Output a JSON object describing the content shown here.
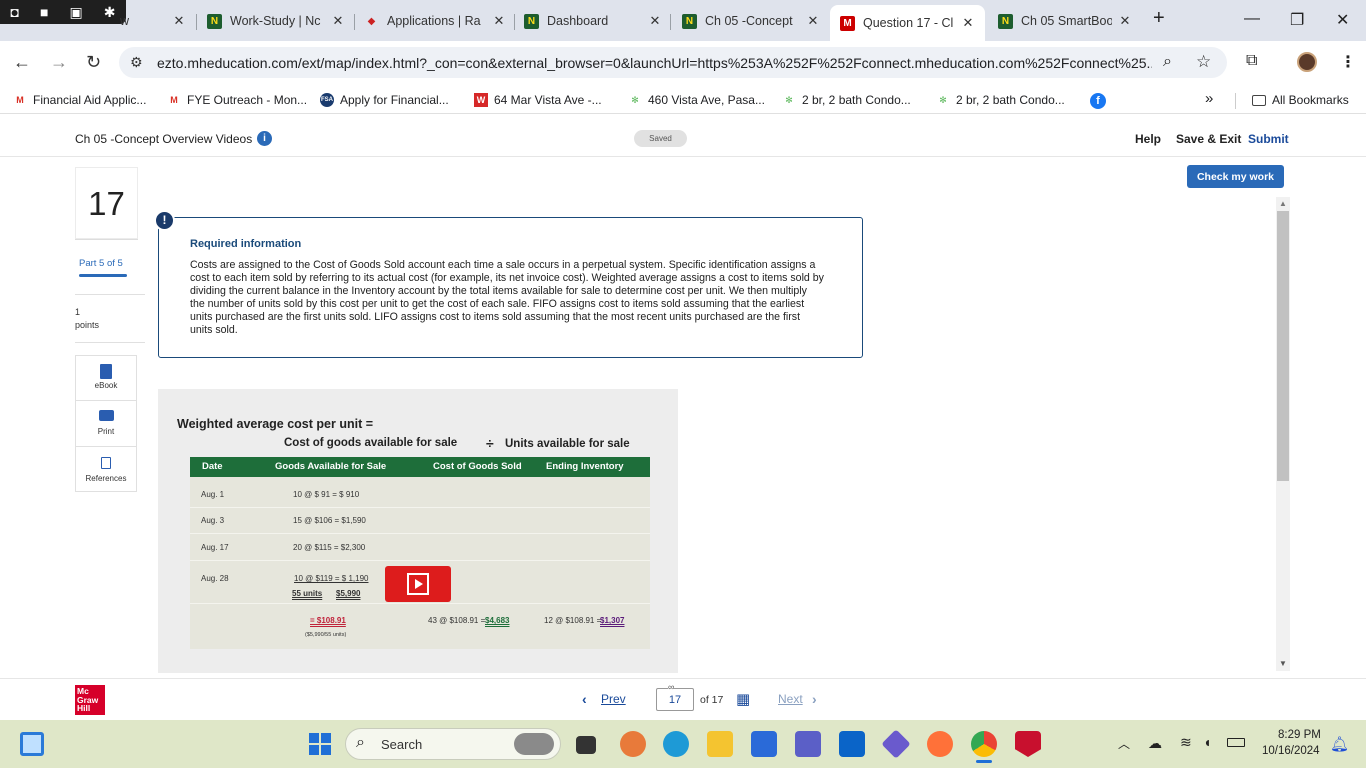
{
  "browser": {
    "tabs": [
      {
        "title": "w",
        "icon": "snip-tool"
      },
      {
        "title": "Work-Study | Nc",
        "icon": "n-icon"
      },
      {
        "title": "Applications | Ra",
        "icon": "app-icon"
      },
      {
        "title": "Dashboard",
        "icon": "n-icon"
      },
      {
        "title": "Ch 05 -Concept",
        "icon": "n-icon"
      },
      {
        "title": "Question 17 - Cl",
        "icon": "m-icon",
        "active": true
      },
      {
        "title": "Ch 05 SmartBoo",
        "icon": "n-icon"
      }
    ],
    "url": "ezto.mheducation.com/ext/map/index.html?_con=con&external_browser=0&launchUrl=https%253A%252F%252Fconnect.mheducation.com%252Fconnect%25...",
    "bookmarks": [
      "Financial Aid Applic...",
      "FYE Outreach - Mon...",
      "Apply for Financial...",
      "64 Mar Vista Ave -...",
      "460 Vista Ave, Pasa...",
      "2 br, 2 bath Condo...",
      "2 br, 2 bath Condo..."
    ],
    "all_bookmarks": "All Bookmarks",
    "overflow": "»"
  },
  "app": {
    "title": "Ch 05 -Concept Overview Videos",
    "saved": "Saved",
    "help": "Help",
    "save_exit": "Save & Exit",
    "submit": "Submit",
    "check_work": "Check my work"
  },
  "sidebar": {
    "question_number": "17",
    "part": "Part 5 of 5",
    "points_value": "1",
    "points_label": "points",
    "ebook": "eBook",
    "print": "Print",
    "references": "References"
  },
  "info": {
    "title": "Required information",
    "text": "Costs are assigned to the Cost of Goods Sold account each time a sale occurs in a perpetual system. Specific identification assigns a cost to each item sold by referring to its actual cost (for example, its net invoice cost). Weighted average assigns a cost to items sold by dividing the current balance in the Inventory account by the total items available for sale to determine cost per unit. We then multiply the number of units sold by this cost per unit to get the cost of each sale. FIFO assigns cost to items sold assuming that the earliest units purchased are the first units sold. LIFO assigns cost to items sold assuming that the most recent units purchased are the first units sold."
  },
  "video": {
    "heading": "Weighted average cost per unit =",
    "subheading_left": "Cost of goods available for sale",
    "divide": "÷",
    "subheading_right": "Units available for sale",
    "columns": [
      "Date",
      "Goods Available for Sale",
      "Cost of Goods Sold",
      "Ending Inventory"
    ],
    "rows": [
      {
        "date": "Aug. 1",
        "goods": "10 @ $  91 = $   910"
      },
      {
        "date": "Aug. 3",
        "goods": "15 @ $106 = $1,590"
      },
      {
        "date": "Aug. 17",
        "goods": "20 @ $115 = $2,300"
      },
      {
        "date": "Aug. 28",
        "goods": "10 @ $119 = $ 1,190"
      }
    ],
    "total_units": "55 units",
    "total_cost": "$5,990",
    "avg_result": "= $108.91",
    "avg_note": "($5,990/55 units)",
    "cogs_prefix": "43 @ $108.91 = ",
    "cogs_value": "$4,683",
    "ending_prefix": "12 @ $108.91 = ",
    "ending_value": "$1,307"
  },
  "footer": {
    "prev": "Prev",
    "page": "17",
    "of": "of 17",
    "next": "Next",
    "logo": [
      "Mc",
      "Graw",
      "Hill"
    ]
  },
  "taskbar": {
    "search_placeholder": "Search",
    "time": "8:29 PM",
    "date": "10/16/2024"
  },
  "colors": {
    "accent_blue": "#2a6ab8",
    "brand_red": "#d6002a",
    "table_green": "#1e6e3a",
    "info_navy": "#1a4a7a"
  }
}
